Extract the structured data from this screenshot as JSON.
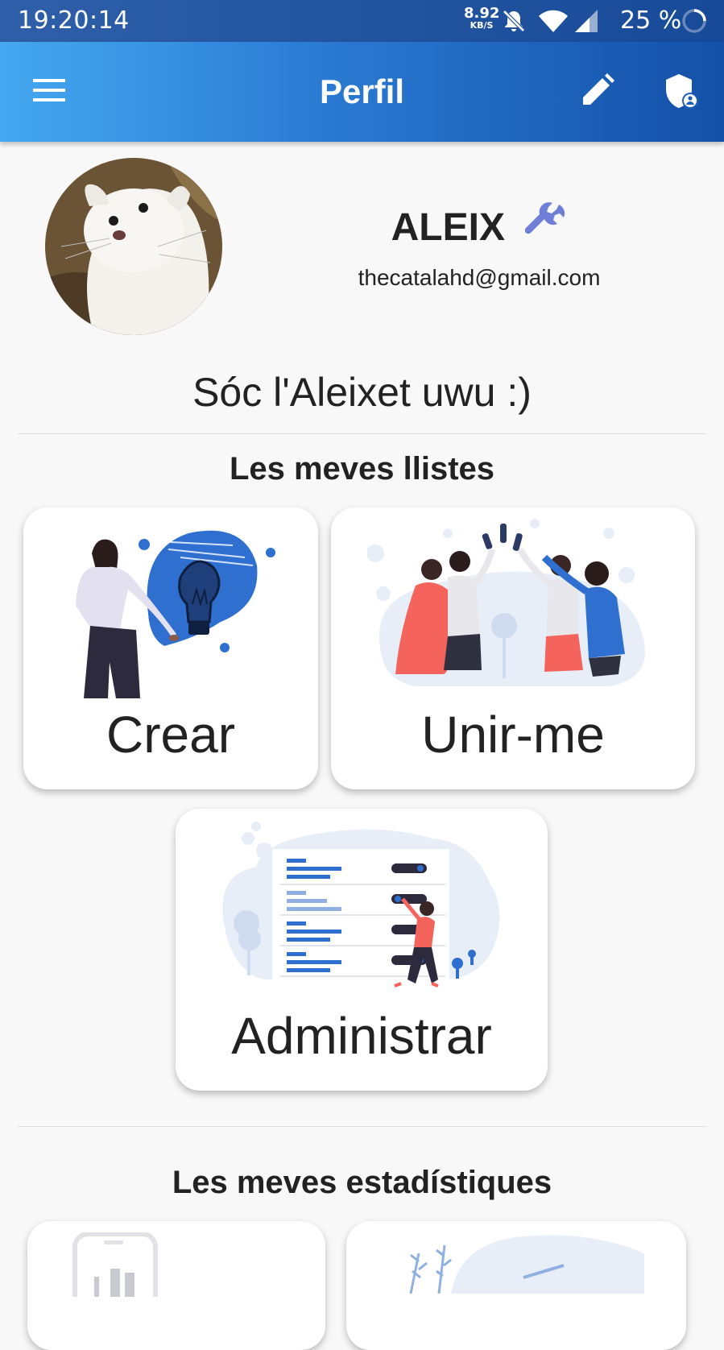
{
  "status_bar": {
    "time": "19:20:14",
    "net_speed": "8.92",
    "net_unit": "KB/S",
    "battery": "25 %",
    "icons": [
      "mute-bell-icon",
      "wifi-icon",
      "signal-icon",
      "battery-ring-icon"
    ]
  },
  "app_bar": {
    "title": "Perfil",
    "menu_icon": "hamburger-menu-icon",
    "edit_icon": "pencil-icon",
    "admin_icon": "admin-shield-icon"
  },
  "profile": {
    "name": "ALEIX",
    "badge_icon": "wrench-icon",
    "email": "thecatalahd@gmail.com",
    "bio": "Sóc l'Aleixet uwu :)"
  },
  "lists_section": {
    "title": "Les meves llistes",
    "cards": [
      {
        "label": "Crear"
      },
      {
        "label": "Unir-me"
      },
      {
        "label": "Administrar"
      }
    ]
  },
  "stats_section": {
    "title": "Les meves estadístiques"
  },
  "colors": {
    "appbar_start": "#45a8f0",
    "appbar_end": "#1450a8",
    "accent_blue": "#2f6fd0",
    "wrench": "#6f7fd8",
    "illustration_red": "#f4645c"
  }
}
